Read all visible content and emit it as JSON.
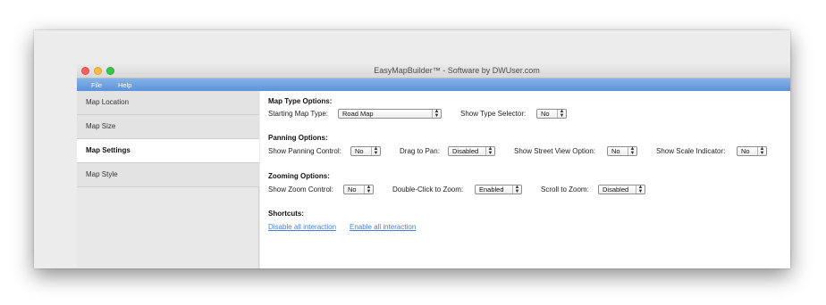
{
  "window": {
    "title": "EasyMapBuilder™ - Software by DWUser.com"
  },
  "menu": {
    "file": "File",
    "help": "Help"
  },
  "sidebar": {
    "items": [
      {
        "label": "Map Location"
      },
      {
        "label": "Map Size"
      },
      {
        "label": "Map Settings"
      },
      {
        "label": "Map Style"
      }
    ]
  },
  "map_type": {
    "heading": "Map Type Options:",
    "starting_label": "Starting Map Type:",
    "starting_value": "Road Map",
    "selector_label": "Show Type Selector:",
    "selector_value": "No"
  },
  "panning": {
    "heading": "Panning Options:",
    "control_label": "Show Panning Control:",
    "control_value": "No",
    "drag_label": "Drag to Pan:",
    "drag_value": "Disabled",
    "street_label": "Show Street View Option:",
    "street_value": "No",
    "scale_label": "Show Scale Indicator:",
    "scale_value": "No"
  },
  "zooming": {
    "heading": "Zooming Options:",
    "control_label": "Show Zoom Control:",
    "control_value": "No",
    "dblclick_label": "Double-Click to Zoom:",
    "dblclick_value": "Enabled",
    "scroll_label": "Scroll to Zoom:",
    "scroll_value": "Disabled"
  },
  "shortcuts": {
    "heading": "Shortcuts:",
    "disable_all": "Disable all interaction",
    "enable_all": "Enable all interaction"
  },
  "icons": {
    "close": "close-dot-icon",
    "minimize": "minimize-dot-icon",
    "maximize": "maximize-dot-icon",
    "stepper": "up-down-arrows-icon"
  },
  "colors": {
    "menubar": "#5b92d8",
    "link": "#4a7fd6",
    "close": "#fc605b",
    "minimize": "#fdbc40",
    "maximize": "#34c84a"
  }
}
